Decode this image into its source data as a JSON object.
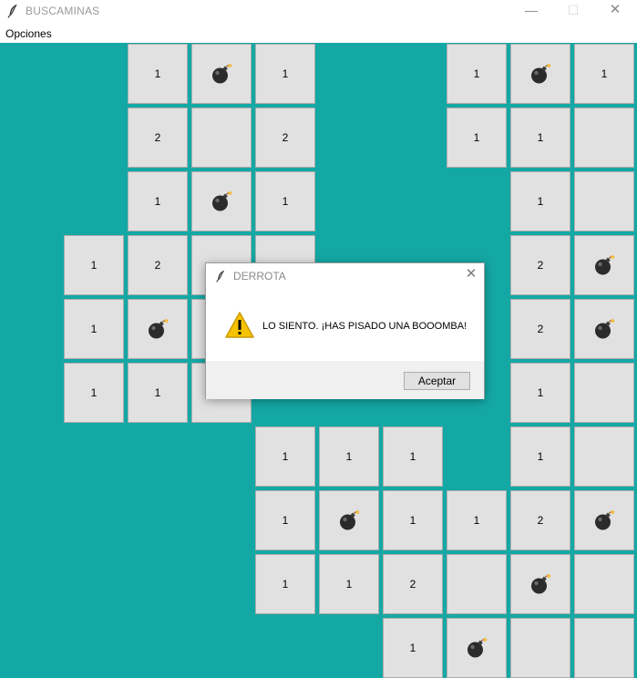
{
  "window": {
    "title": "BUSCAMINAS",
    "controls": {
      "minimize": "—",
      "maximize": "☐",
      "close": "✕"
    }
  },
  "menu": {
    "items": [
      "Opciones"
    ]
  },
  "colors": {
    "board_background": "#14a8a5",
    "cell_background": "#e1e1e1",
    "cell_border": "#ababab"
  },
  "board": {
    "grid_columns": 10,
    "grid_rows": 10,
    "cells": [
      {
        "r": 0,
        "c": 2,
        "v": "1"
      },
      {
        "r": 0,
        "c": 3,
        "v": "bomb"
      },
      {
        "r": 0,
        "c": 4,
        "v": "1"
      },
      {
        "r": 0,
        "c": 7,
        "v": "1"
      },
      {
        "r": 0,
        "c": 8,
        "v": "bomb"
      },
      {
        "r": 0,
        "c": 9,
        "v": "1"
      },
      {
        "r": 1,
        "c": 2,
        "v": "2"
      },
      {
        "r": 1,
        "c": 3,
        "v": ""
      },
      {
        "r": 1,
        "c": 4,
        "v": "2"
      },
      {
        "r": 1,
        "c": 7,
        "v": "1"
      },
      {
        "r": 1,
        "c": 8,
        "v": "1"
      },
      {
        "r": 1,
        "c": 9,
        "v": ""
      },
      {
        "r": 2,
        "c": 2,
        "v": "1"
      },
      {
        "r": 2,
        "c": 3,
        "v": "bomb"
      },
      {
        "r": 2,
        "c": 4,
        "v": "1"
      },
      {
        "r": 2,
        "c": 8,
        "v": "1"
      },
      {
        "r": 2,
        "c": 9,
        "v": ""
      },
      {
        "r": 3,
        "c": 1,
        "v": "1"
      },
      {
        "r": 3,
        "c": 2,
        "v": "2"
      },
      {
        "r": 3,
        "c": 3,
        "v": ""
      },
      {
        "r": 3,
        "c": 4,
        "v": ""
      },
      {
        "r": 3,
        "c": 8,
        "v": "2"
      },
      {
        "r": 3,
        "c": 9,
        "v": "bomb"
      },
      {
        "r": 4,
        "c": 1,
        "v": "1"
      },
      {
        "r": 4,
        "c": 2,
        "v": "bomb"
      },
      {
        "r": 4,
        "c": 3,
        "v": ""
      },
      {
        "r": 4,
        "c": 8,
        "v": "2"
      },
      {
        "r": 4,
        "c": 9,
        "v": "bomb"
      },
      {
        "r": 5,
        "c": 1,
        "v": "1"
      },
      {
        "r": 5,
        "c": 2,
        "v": "1"
      },
      {
        "r": 5,
        "c": 3,
        "v": ""
      },
      {
        "r": 5,
        "c": 8,
        "v": "1"
      },
      {
        "r": 5,
        "c": 9,
        "v": ""
      },
      {
        "r": 6,
        "c": 4,
        "v": "1"
      },
      {
        "r": 6,
        "c": 5,
        "v": "1"
      },
      {
        "r": 6,
        "c": 6,
        "v": "1"
      },
      {
        "r": 6,
        "c": 8,
        "v": "1"
      },
      {
        "r": 6,
        "c": 9,
        "v": ""
      },
      {
        "r": 7,
        "c": 4,
        "v": "1"
      },
      {
        "r": 7,
        "c": 5,
        "v": "bomb"
      },
      {
        "r": 7,
        "c": 6,
        "v": "1"
      },
      {
        "r": 7,
        "c": 7,
        "v": "1"
      },
      {
        "r": 7,
        "c": 8,
        "v": "2"
      },
      {
        "r": 7,
        "c": 9,
        "v": "bomb"
      },
      {
        "r": 8,
        "c": 4,
        "v": "1"
      },
      {
        "r": 8,
        "c": 5,
        "v": "1"
      },
      {
        "r": 8,
        "c": 6,
        "v": "2"
      },
      {
        "r": 8,
        "c": 7,
        "v": ""
      },
      {
        "r": 8,
        "c": 8,
        "v": "bomb"
      },
      {
        "r": 8,
        "c": 9,
        "v": ""
      },
      {
        "r": 9,
        "c": 6,
        "v": "1"
      },
      {
        "r": 9,
        "c": 7,
        "v": "bomb"
      },
      {
        "r": 9,
        "c": 8,
        "v": ""
      },
      {
        "r": 9,
        "c": 9,
        "v": ""
      }
    ]
  },
  "dialog": {
    "title": "DERROTA",
    "icon": "warning-icon",
    "message": "LO SIENTO. ¡HAS PISADO UNA BOOOMBA!",
    "ok_label": "Aceptar",
    "close": "✕"
  }
}
